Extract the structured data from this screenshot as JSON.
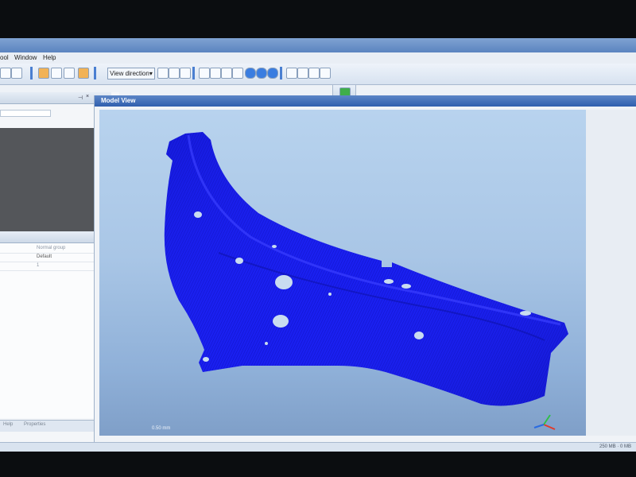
{
  "menubar": {
    "items": [
      "ool",
      "Window",
      "Help"
    ]
  },
  "toolbar": {
    "view_direction_label": "View direction▾"
  },
  "left_panel": {
    "properties": {
      "rows": [
        {
          "value": "Normal group"
        },
        {
          "value": "Default"
        },
        {
          "value": "1"
        }
      ]
    },
    "tabs": [
      "Help",
      "Properties"
    ]
  },
  "model_view": {
    "title": "Model View",
    "scale_label": "0.50 mm"
  },
  "status": {
    "right_text": "250 MB  ·  0 MB"
  },
  "colors": {
    "accent": "#2f5fae",
    "part_blue": "#1a1ff0",
    "canvas_top": "#b8d3ee",
    "canvas_bottom": "#7f9fc8"
  },
  "icons": [
    "arrow-icon",
    "view-direction-icon",
    "cube-icon",
    "shading-icon",
    "layout-icon",
    "add-icon",
    "axis-triad-icon",
    "pin-icon",
    "close-icon"
  ]
}
